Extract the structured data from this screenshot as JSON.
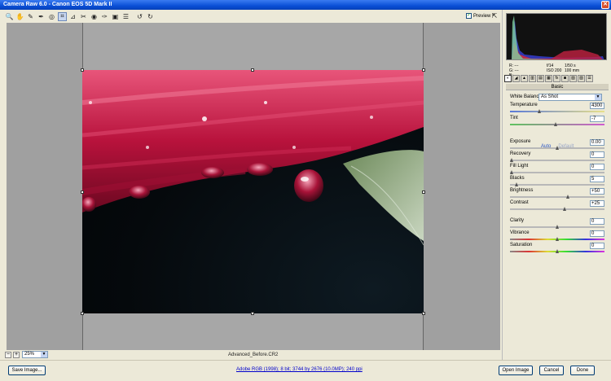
{
  "window": {
    "title": "Camera Raw 6.0  -  Canon EOS 5D Mark II"
  },
  "toolbar": {
    "tools": [
      {
        "name": "zoom-tool-icon",
        "glyph": "🔍"
      },
      {
        "name": "hand-tool-icon",
        "glyph": "✋"
      },
      {
        "name": "white-balance-tool-icon",
        "glyph": "✎"
      },
      {
        "name": "color-sampler-icon",
        "glyph": "✒"
      },
      {
        "name": "targeted-adjustment-icon",
        "glyph": "◎"
      },
      {
        "name": "crop-tool-icon",
        "glyph": "⌗"
      },
      {
        "name": "straighten-tool-icon",
        "glyph": "⊿"
      },
      {
        "name": "spot-removal-icon",
        "glyph": "✂"
      },
      {
        "name": "red-eye-icon",
        "glyph": "◉"
      },
      {
        "name": "adjustment-brush-icon",
        "glyph": "✑"
      },
      {
        "name": "graduated-filter-icon",
        "glyph": "▣"
      },
      {
        "name": "preferences-icon",
        "glyph": "☰"
      },
      {
        "name": "rotate-left-icon",
        "glyph": "↺"
      },
      {
        "name": "rotate-right-icon",
        "glyph": "↻"
      }
    ],
    "preview_label": "Preview"
  },
  "status": {
    "zoom": "25%",
    "filename": "Advanced_Before.CR2"
  },
  "info": {
    "r_label": "R:",
    "g_label": "G:",
    "b_label": "B:",
    "dashes": "---",
    "aperture": "f/14",
    "shutter": "1/50 s",
    "iso": "ISO 200",
    "focal": "100 mm"
  },
  "panel": {
    "section_title": "Basic",
    "white_balance_label": "White Balance:",
    "white_balance_value": "As Shot",
    "auto_label": "Auto",
    "default_label": "Default",
    "controls": [
      {
        "id": "temperature",
        "label": "Temperature",
        "value": "4300",
        "fraction": 0.3
      },
      {
        "id": "tint",
        "label": "Tint",
        "value": "-7",
        "fraction": 0.48
      },
      {
        "id": "exposure",
        "label": "Exposure",
        "value": "0.00",
        "fraction": 0.5
      },
      {
        "id": "recovery",
        "label": "Recovery",
        "value": "0",
        "fraction": 0.0
      },
      {
        "id": "fill-light",
        "label": "Fill Light",
        "value": "0",
        "fraction": 0.0
      },
      {
        "id": "blacks",
        "label": "Blacks",
        "value": "5",
        "fraction": 0.05
      },
      {
        "id": "brightness",
        "label": "Brightness",
        "value": "+50",
        "fraction": 0.62
      },
      {
        "id": "contrast",
        "label": "Contrast",
        "value": "+25",
        "fraction": 0.58
      },
      {
        "id": "clarity",
        "label": "Clarity",
        "value": "0",
        "fraction": 0.5
      },
      {
        "id": "vibrance",
        "label": "Vibrance",
        "value": "0",
        "fraction": 0.5
      },
      {
        "id": "saturation",
        "label": "Saturation",
        "value": "0",
        "fraction": 0.5
      }
    ]
  },
  "bottom": {
    "save_label": "Save Image...",
    "workflow_link": "Adobe RGB (1998); 8 bit; 3744 by 2676 (10.0MP); 240 ppi",
    "open_label": "Open Image",
    "cancel_label": "Cancel",
    "done_label": "Done"
  },
  "colors": {
    "accent": "#0a4fd6",
    "petal": "#c0183f"
  }
}
